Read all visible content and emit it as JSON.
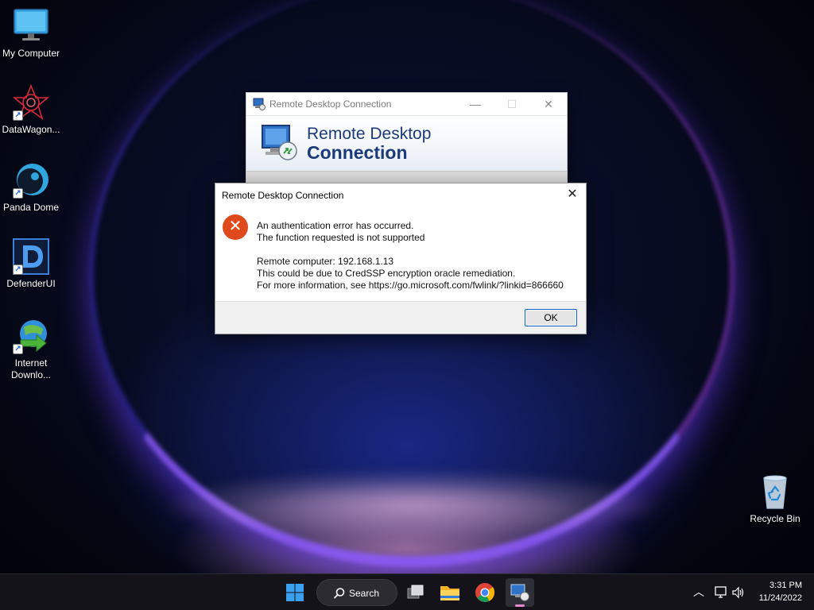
{
  "desktop": {
    "icons": [
      {
        "label": "My Computer"
      },
      {
        "label": "DataWagon..."
      },
      {
        "label": "Panda Dome"
      },
      {
        "label": "DefenderUI"
      },
      {
        "label_line1": "Internet",
        "label_line2": "Downlo..."
      },
      {
        "label": "Recycle Bin"
      }
    ]
  },
  "rdc_window": {
    "title": "Remote Desktop Connection",
    "banner_line1": "Remote Desktop",
    "banner_line2": "Connection",
    "minimize": "—",
    "maximize": "☐",
    "close": "✕"
  },
  "error_dialog": {
    "title": "Remote Desktop Connection",
    "close": "✕",
    "icon": "✕",
    "line1": "An authentication error has occurred.",
    "line2": "The function requested is not supported",
    "line3": "Remote computer: 192.168.1.13",
    "line4": "This could be due to CredSSP encryption oracle remediation.",
    "line5": "For more information, see https://go.microsoft.com/fwlink/?linkid=866660",
    "ok_label": "OK"
  },
  "taskbar": {
    "search_label": "Search",
    "time": "3:31 PM",
    "date": "11/24/2022",
    "tray_chevron": "︿"
  },
  "colors": {
    "error_red": "#e0491b",
    "accent_blue": "#0a64d2",
    "rdc_title_blue": "#1b3a7a"
  }
}
